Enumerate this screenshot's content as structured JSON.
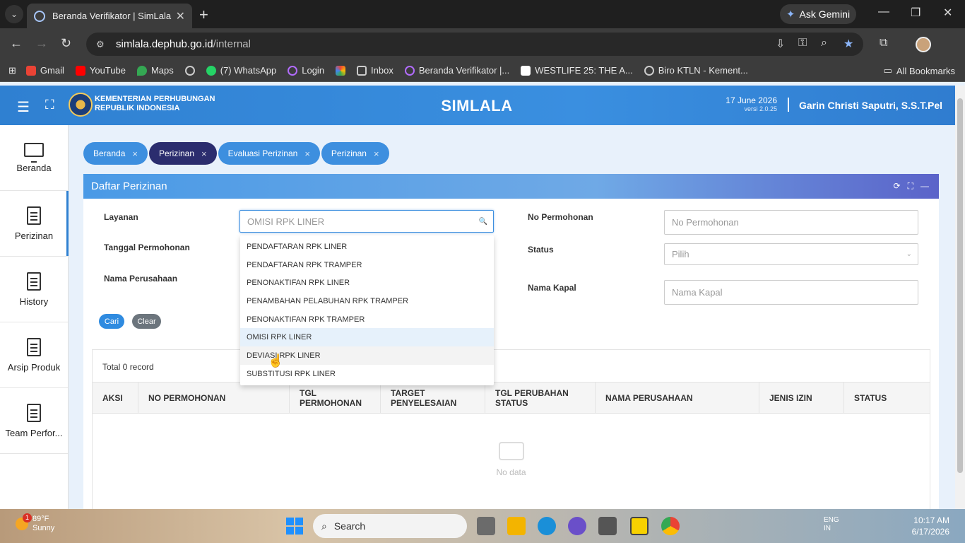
{
  "browser": {
    "tab_title": "Beranda Verifikator | SimLala",
    "gemini": "Ask Gemini",
    "url_host": "simlala.dephub.go.id",
    "url_path": "/internal",
    "bookmarks": [
      "Gmail",
      "YouTube",
      "Maps",
      "(7) WhatsApp",
      "Login",
      "Inbox",
      "Beranda Verifikator |...",
      "WESTLIFE 25: THE A...",
      "Biro KTLN - Kement..."
    ],
    "all_bookmarks": "All Bookmarks"
  },
  "header": {
    "ministry_line1": "KEMENTERIAN PERHUBUNGAN",
    "ministry_line2": "REPUBLIK INDONESIA",
    "app_title": "SIMLALA",
    "date": "17 June 2026",
    "version": "versi 2.0.25",
    "user": "Garin Christi Saputri, S.S.T.Pel"
  },
  "sidebar": {
    "items": [
      {
        "label": "Beranda"
      },
      {
        "label": "Perizinan"
      },
      {
        "label": "History"
      },
      {
        "label": "Arsip Produk"
      },
      {
        "label": "Team Perfor..."
      }
    ]
  },
  "breadcrumbs": [
    "Beranda",
    "Perizinan",
    "Evaluasi Perizinan",
    "Perizinan"
  ],
  "card": {
    "title": "Daftar Perizinan",
    "labels": {
      "layanan": "Layanan",
      "tanggal": "Tanggal Permohonan",
      "nama_perusahaan": "Nama Perusahaan",
      "no_permohonan": "No Permohonan",
      "status": "Status",
      "nama_kapal": "Nama Kapal"
    },
    "layanan_value": "OMISI RPK LINER",
    "no_permohonan_placeholder": "No Permohonan",
    "status_placeholder": "Pilih",
    "nama_kapal_placeholder": "Nama Kapal",
    "btn_cari": "Cari",
    "btn_clear": "Clear",
    "total": "Total 0 record",
    "columns": [
      "AKSI",
      "NO PERMOHONAN",
      "TGL PERMOHONAN",
      "TARGET PENYELESAIAN",
      "TGL PERUBAHAN STATUS",
      "NAMA PERUSAHAAN",
      "JENIS IZIN",
      "STATUS"
    ],
    "empty": "No data"
  },
  "dropdown": {
    "options": [
      "PENDAFTARAN RPK LINER",
      "PENDAFTARAN RPK TRAMPER",
      "PENONAKTIFAN RPK LINER",
      "PENAMBAHAN PELABUHAN RPK TRAMPER",
      "PENONAKTIFAN RPK TRAMPER",
      "OMISI RPK LINER",
      "DEVIASI RPK LINER",
      "SUBSTITUSI RPK LINER"
    ],
    "selected_index": 5,
    "hover_index": 6
  },
  "taskbar": {
    "weather_temp": "89°F",
    "weather_desc": "Sunny",
    "weather_badge": "1",
    "search": "Search",
    "lang1": "ENG",
    "lang2": "IN",
    "time": "10:17 AM",
    "date": "6/17/2026"
  }
}
